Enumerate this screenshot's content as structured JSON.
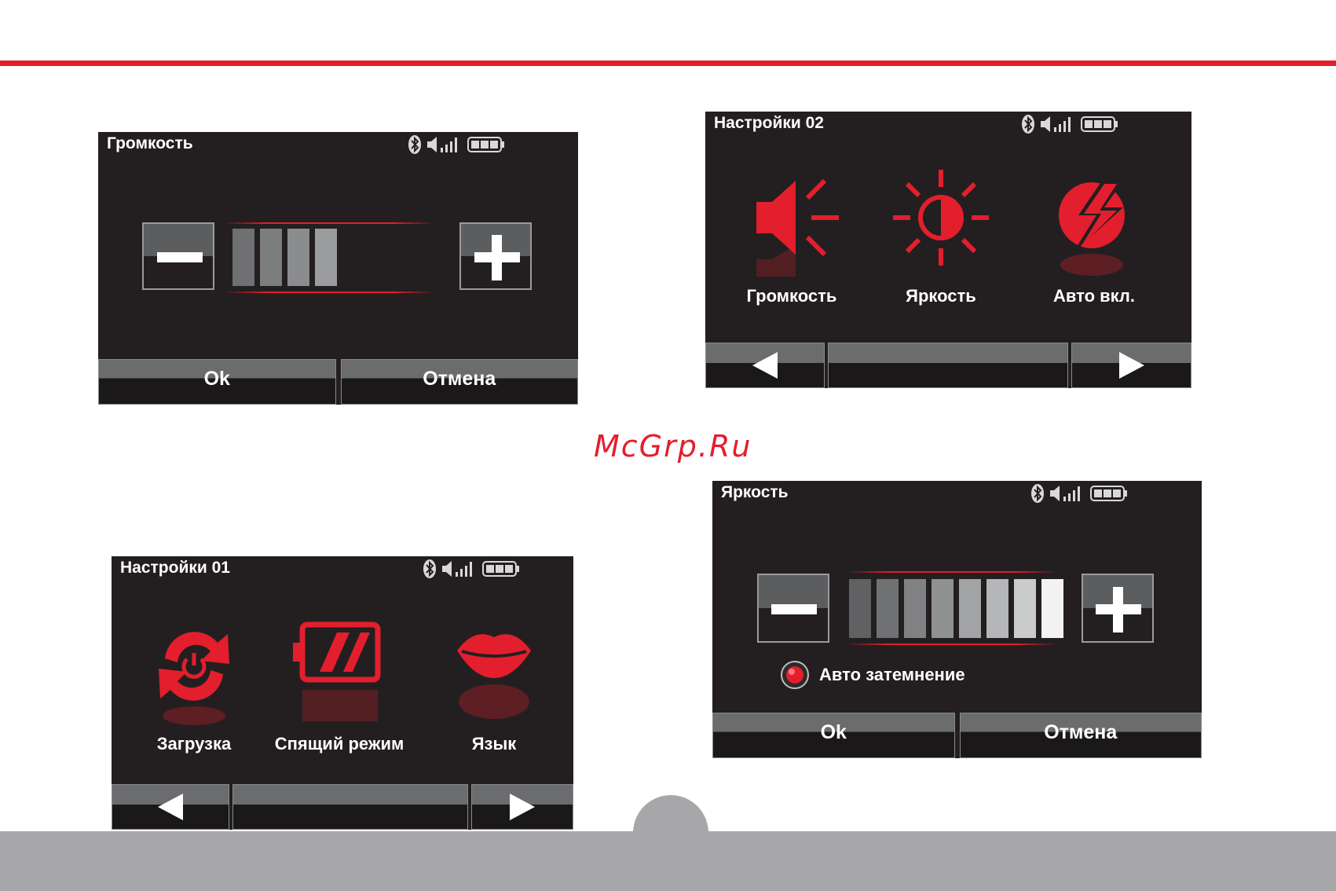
{
  "watermark": "McGrp.Ru",
  "screen_volume": {
    "title": "Громкость",
    "level_bars": 4,
    "ok_label": "Ok",
    "cancel_label": "Отмена"
  },
  "screen_settings02": {
    "title": "Настройки 02",
    "items": [
      {
        "label": "Громкость",
        "icon": "speaker-icon"
      },
      {
        "label": "Яркость",
        "icon": "brightness-sun-icon"
      },
      {
        "label": "Авто вкл.",
        "icon": "lightning-icon"
      }
    ]
  },
  "screen_settings01": {
    "title": "Настройки 01",
    "items": [
      {
        "label": "Загрузка",
        "icon": "reboot-power-icon"
      },
      {
        "label": "Спящий режим",
        "icon": "sleep-battery-icon"
      },
      {
        "label": "Язык",
        "icon": "lips-icon"
      }
    ]
  },
  "screen_brightness": {
    "title": "Яркость",
    "level_bars": 8,
    "auto_dim_label": "Авто затемнение",
    "ok_label": "Ok",
    "cancel_label": "Отмена"
  },
  "colors": {
    "accent": "#e31e2d",
    "screen_bg": "#231f20",
    "footer": "#a7a6a8"
  }
}
